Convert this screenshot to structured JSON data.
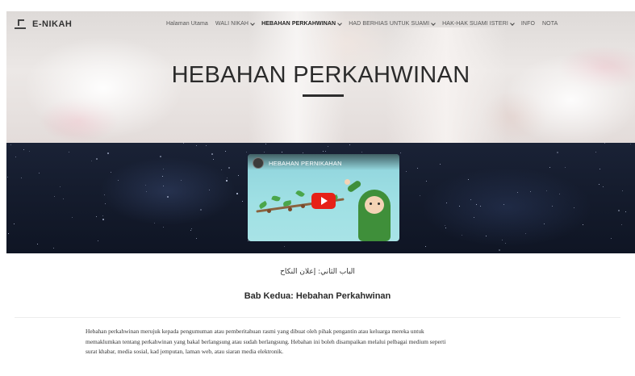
{
  "brand": {
    "name": "E-NIKAH"
  },
  "nav": {
    "items": [
      {
        "label": "Halaman Utama",
        "dropdown": false,
        "active": false
      },
      {
        "label": "WALI NIKAH",
        "dropdown": true,
        "active": false
      },
      {
        "label": "HEBAHAN PERKAHWINAN",
        "dropdown": true,
        "active": true
      },
      {
        "label": "HAD BERHIAS UNTUK SUAMI",
        "dropdown": true,
        "active": false
      },
      {
        "label": "HAK-HAK SUAMI ISTERI",
        "dropdown": true,
        "active": false
      },
      {
        "label": "INFO",
        "dropdown": false,
        "active": false
      },
      {
        "label": "NOTA",
        "dropdown": false,
        "active": false
      }
    ]
  },
  "hero": {
    "title": "HEBAHAN PERKAHWINAN"
  },
  "video": {
    "title": "HEBAHAN PERNIKAHAN"
  },
  "content": {
    "arabic_heading": "الباب الثاني: إعلان النكاح",
    "subheading": "Bab Kedua: Hebahan Perkahwinan",
    "paragraph_lines": [
      "Hebahan perkahwinan merujuk kepada pengumuman atau pemberitahuan rasmi yang dibuat oleh pihak pengantin atau keluarga mereka untuk",
      "memaklumkan tentang perkahwinan yang bakal berlangsung atau sudah berlangsung. Hebahan ini boleh disampaikan melalui pelbagai medium seperti",
      "surat khabar, media sosial, kad jemputan, laman web, atau siaran media elektronik."
    ]
  }
}
